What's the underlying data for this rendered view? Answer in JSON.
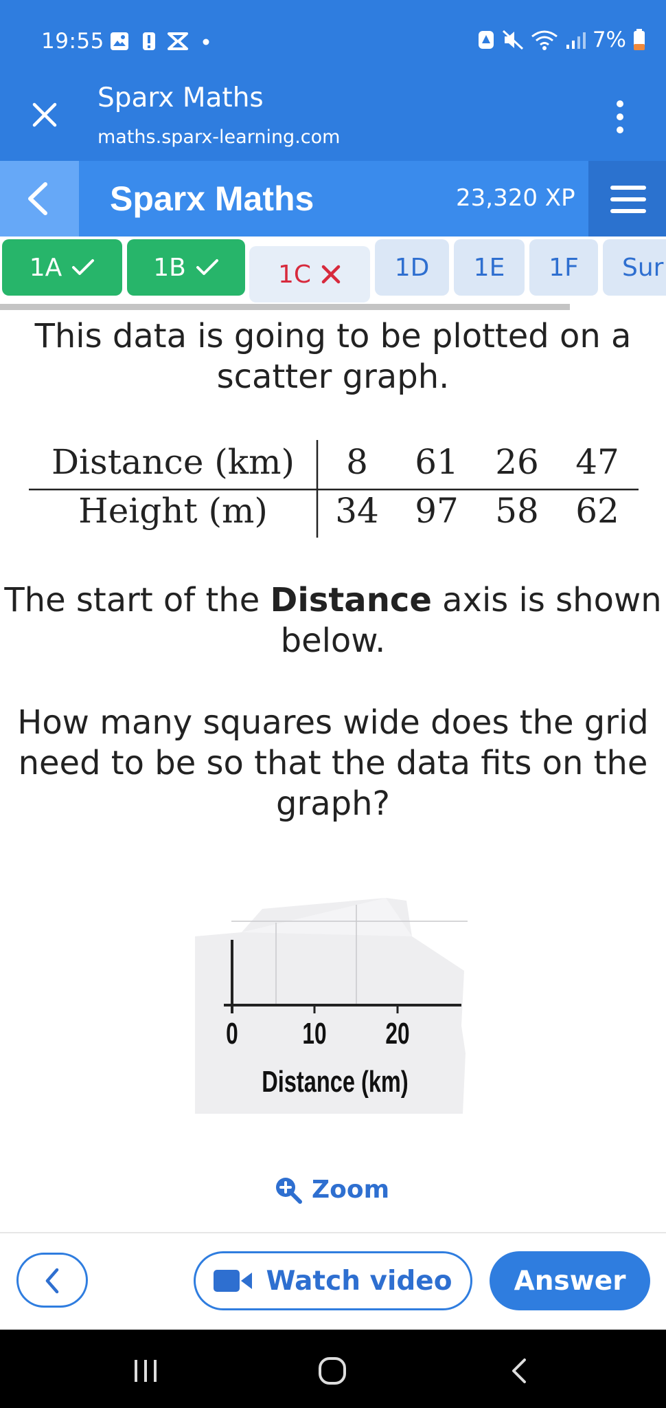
{
  "status_bar": {
    "time": "19:55",
    "battery": "7%",
    "icons": [
      "gallery-icon",
      "alert-icon",
      "voicemail-icon",
      "dot-icon",
      "nfc-icon",
      "mute-icon",
      "wifi-icon",
      "signal-icon",
      "battery-icon"
    ]
  },
  "browser": {
    "title": "Sparx Maths",
    "url": "maths.sparx-learning.com",
    "icons": [
      "close-icon",
      "more-vert-icon"
    ]
  },
  "app_header": {
    "title": "Sparx Maths",
    "xp": "23,320 XP",
    "icons": [
      "chevron-left-icon",
      "hamburger-menu-icon"
    ]
  },
  "tabs": [
    {
      "label": "1A",
      "state": "done"
    },
    {
      "label": "1B",
      "state": "done"
    },
    {
      "label": "1C",
      "state": "wrong"
    },
    {
      "label": "1D",
      "state": "todo"
    },
    {
      "label": "1E",
      "state": "todo"
    },
    {
      "label": "1F",
      "state": "todo"
    },
    {
      "label": "Sur",
      "state": "todo"
    }
  ],
  "question": {
    "intro_line1": "This data is going to be plotted on a",
    "intro_line2": "scatter graph.",
    "table": {
      "row1_label": "Distance (km)",
      "row1_values": [
        "8",
        "61",
        "26",
        "47"
      ],
      "row2_label": "Height (m)",
      "row2_values": [
        "34",
        "97",
        "58",
        "62"
      ]
    },
    "axis_sentence_pre": "The start of the ",
    "axis_sentence_bold": "Distance",
    "axis_sentence_post": " axis is shown",
    "axis_sentence_line2": "below.",
    "ask_line1": "How many squares wide does the grid",
    "ask_line2": "need to be so that the data fits on the",
    "ask_line3": "graph?"
  },
  "axis_figure": {
    "ticks": [
      "0",
      "10",
      "20"
    ],
    "label": "Distance (km)"
  },
  "zoom_label": "Zoom",
  "buttons": {
    "watch_video": "Watch video",
    "answer": "Answer"
  },
  "colors": {
    "brand_blue": "#2f7ddf",
    "done_green": "#27b56a",
    "wrong_red": "#d72a3d"
  }
}
